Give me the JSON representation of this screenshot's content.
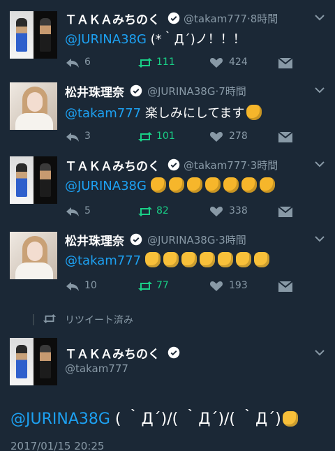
{
  "tweets": [
    {
      "display_name": "ＴＡＫＡみちのく",
      "handle": "@takam777",
      "time": "8時間",
      "mention": "@JURINA38G",
      "text": " (*｀Д´)ノ！！！",
      "replies": "6",
      "retweets": "111",
      "likes": "424",
      "avatar": "taka-avatar"
    },
    {
      "display_name": "松井珠理奈",
      "handle": "@JURINA38G",
      "time": "7時間",
      "mention": "@takam777",
      "text": " 楽しみにしてます",
      "emoji": "raised-fist",
      "replies": "3",
      "retweets": "101",
      "likes": "278",
      "avatar": "jurina-avatar"
    },
    {
      "display_name": "ＴＡＫＡみちのく",
      "handle": "@takam777",
      "time": "3時間",
      "mention": "@JURINA38G",
      "text": " ",
      "emoji": "oncoming-fist x7",
      "replies": "5",
      "retweets": "82",
      "likes": "338",
      "avatar": "taka-avatar"
    },
    {
      "display_name": "松井珠理奈",
      "handle": "@JURINA38G",
      "time": "3時間",
      "mention": "@takam777",
      "text": " ",
      "emoji": "raised-hand x7",
      "replies": "10",
      "retweets": "77",
      "likes": "193",
      "avatar": "jurina-avatar"
    }
  ],
  "retweet_note": "リツイート済み",
  "main_tweet": {
    "display_name": "ＴＡＫＡみちのく",
    "handle": "@takam777",
    "mention": "@JURINA38G",
    "text": " ( ｀Д´)/( ｀Д´)/( ｀Д´)",
    "emoji": "victory-hand",
    "timestamp": "2017/01/15 20:25"
  },
  "separator": "·",
  "colors": {
    "background": "#1b2836",
    "accent": "#1da1f2",
    "retweet": "#19cf86",
    "muted": "#8899a6"
  }
}
